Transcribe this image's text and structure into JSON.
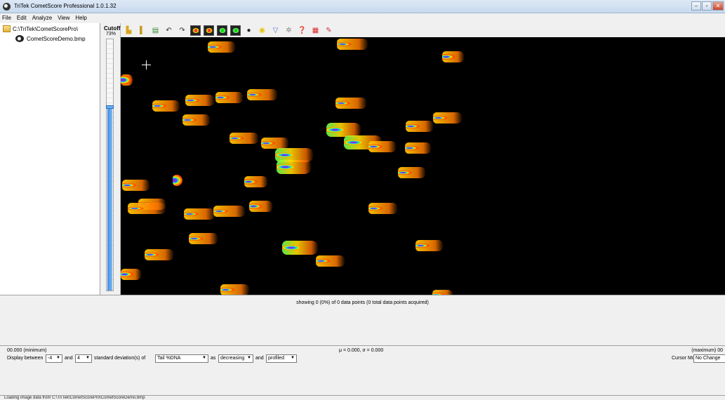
{
  "window": {
    "title": "TriTek CometScore Professional 1.0.1.32",
    "controls": [
      "minimize-icon",
      "maximize-icon",
      "close-icon"
    ]
  },
  "menu": [
    "File",
    "Edit",
    "Analyze",
    "View",
    "Help"
  ],
  "tree": {
    "folder": "C:\\TriTek\\CometScorePro\\",
    "file": "CometScoreDemo.bmp"
  },
  "cutoff": {
    "label": "Cutoff",
    "value": "73%",
    "level_fraction": 0.73
  },
  "toolbar": {
    "icons": [
      "open-folder-icon",
      "open-file-icon",
      "export-icon",
      "undo-icon",
      "redo-icon",
      "comet-dark-icon",
      "comet-dark-2-icon",
      "comet-green-icon",
      "comet-green-2-icon",
      "comet-circle-icon",
      "comet-ring-icon",
      "filter-icon",
      "settings-icon",
      "help-icon",
      "pdf-icon",
      "about-icon"
    ]
  },
  "stats": {
    "showing": "showing 0 (0%) of 0 data points (0 total data points acquired)",
    "min_label": "00.000 (minimum)",
    "mu_sigma": "μ = 0.000, σ = 0.000",
    "max_label": "(maximum) 00"
  },
  "display": {
    "prefix": "Display between",
    "low": "-4",
    "and1": "and",
    "high": "4",
    "sd_text": "standard deviation(s) of",
    "metric": "Tail %DNA",
    "as": "as",
    "order": "decreasing",
    "and2": "and",
    "mode": "profiled",
    "cursor_label": "Cursor Mode",
    "cursor_value": "No Change"
  },
  "status": "Loading image data from C:\\TriTek\\CometScorePro\\CometScoreDemo.bmp"
}
